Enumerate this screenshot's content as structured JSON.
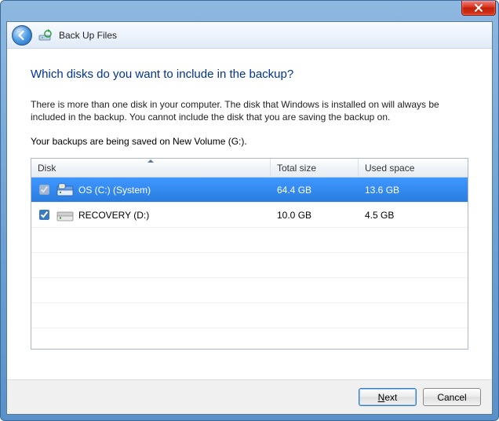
{
  "nav": {
    "title": "Back Up Files"
  },
  "page": {
    "heading": "Which disks do you want to include in the backup?",
    "description": "There is more than one disk in your computer. The disk that Windows is installed on will always be included in the backup. You cannot include the disk that you are saving the backup on.",
    "saved_on": "Your backups are being saved on New Volume (G:)."
  },
  "grid": {
    "columns": {
      "disk": "Disk",
      "total": "Total size",
      "used": "Used space"
    },
    "rows": [
      {
        "name": "OS (C:) (System)",
        "total": "64.4 GB",
        "used": "13.6 GB",
        "checked": true,
        "disabled": true,
        "selected": true
      },
      {
        "name": "RECOVERY (D:)",
        "total": "10.0 GB",
        "used": "4.5 GB",
        "checked": true,
        "disabled": false,
        "selected": false
      }
    ]
  },
  "buttons": {
    "next": "Next",
    "cancel": "Cancel"
  }
}
